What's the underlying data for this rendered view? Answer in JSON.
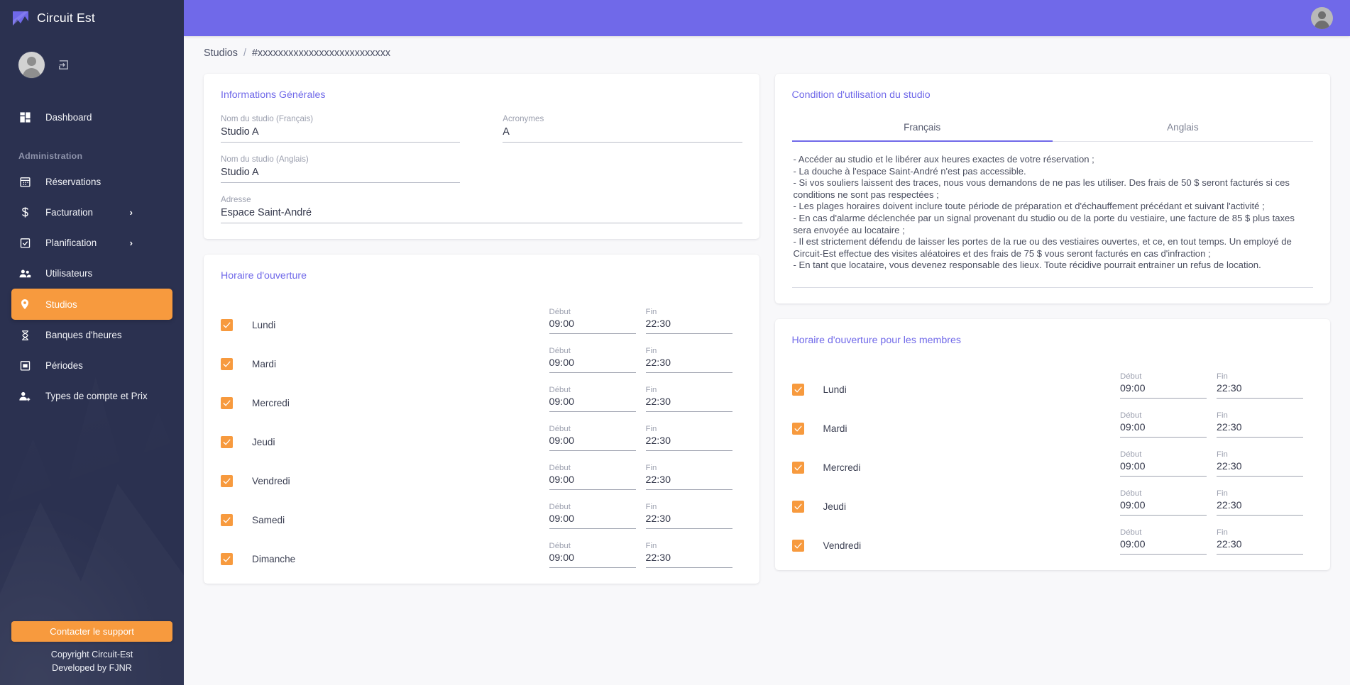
{
  "brand": {
    "name": "Circuit Est",
    "logo_icon": "mountain-logo-icon"
  },
  "sidebar": {
    "user": {
      "avatar_icon": "user-avatar-icon",
      "logout_icon": "logout-icon"
    },
    "dashboard": {
      "label": "Dashboard",
      "icon": "dashboard-grid-icon"
    },
    "section_label": "Administration",
    "items": [
      {
        "label": "Réservations",
        "icon": "calendar-grid-icon",
        "chevron": false
      },
      {
        "label": "Facturation",
        "icon": "dollar-icon",
        "chevron": true,
        "chevron_glyph": "›"
      },
      {
        "label": "Planification",
        "icon": "calendar-check-icon",
        "chevron": true,
        "chevron_glyph": "›"
      },
      {
        "label": "Utilisateurs",
        "icon": "people-icon",
        "chevron": false
      },
      {
        "label": "Studios",
        "icon": "map-pin-icon",
        "chevron": false,
        "active": true
      },
      {
        "label": "Banques d'heures",
        "icon": "hourglass-icon",
        "chevron": false
      },
      {
        "label": "Périodes",
        "icon": "calendar-block-icon",
        "chevron": false
      },
      {
        "label": "Types de compte et Prix",
        "icon": "person-gear-icon",
        "chevron": false
      }
    ],
    "support_button": "Contacter le support",
    "copyright_line1": "Copyright Circuit-Est",
    "copyright_line2": "Developed by FJNR"
  },
  "topbar": {
    "avatar_icon": "user-avatar-icon"
  },
  "breadcrumb": {
    "root": "Studios",
    "separator": "/",
    "current": "#xxxxxxxxxxxxxxxxxxxxxxxxxx"
  },
  "general_info": {
    "title": "Informations Générales",
    "fields": {
      "name_fr": {
        "label": "Nom du studio (Français)",
        "value": "Studio A",
        "placeholder": "Nom du studio (Français)"
      },
      "acronyms": {
        "label": "Acronymes",
        "value": "A",
        "placeholder": "Acronymes"
      },
      "name_en": {
        "label": "Nom du studio (Anglais)",
        "value": "Studio A",
        "placeholder": "Nom du studio (Anglais)"
      },
      "address": {
        "label": "Adresse",
        "value": "Espace Saint-André",
        "placeholder": "Adresse"
      }
    }
  },
  "conditions": {
    "title": "Condition d'utilisation du studio",
    "tabs": [
      {
        "label": "Français",
        "active": true
      },
      {
        "label": "Anglais",
        "active": false
      }
    ],
    "text": "- Accéder au studio et le libérer aux heures exactes de votre réservation ;\n- La douche à l'espace Saint-André n'est pas accessible.\n- Si vos souliers laissent des traces, nous vous demandons de ne pas les utiliser. Des frais de 50 $ seront facturés si ces conditions ne sont pas respectées ;\n- Les plages horaires doivent inclure toute période de préparation et d'échauffement précédant et suivant l'activité ;\n- En cas d'alarme déclenchée par un signal provenant du studio ou de la porte du vestiaire, une facture de 85 $ plus taxes sera envoyée au locataire ;\n- Il est strictement défendu de laisser les portes de la rue ou des vestiaires ouvertes, et ce, en tout temps. Un employé de Circuit-Est effectue des visites aléatoires et des frais de 75 $ vous seront facturés en cas d'infraction ;\n- En tant que locataire, vous devenez responsable des lieux. Toute récidive pourrait entrainer un refus de location."
  },
  "schedule_public": {
    "title": "Horaire d'ouverture",
    "col_start_label": "Début",
    "col_end_label": "Fin",
    "days": [
      {
        "day": "Lundi",
        "checked": true,
        "start": "09:00",
        "end": "22:30"
      },
      {
        "day": "Mardi",
        "checked": true,
        "start": "09:00",
        "end": "22:30"
      },
      {
        "day": "Mercredi",
        "checked": true,
        "start": "09:00",
        "end": "22:30"
      },
      {
        "day": "Jeudi",
        "checked": true,
        "start": "09:00",
        "end": "22:30"
      },
      {
        "day": "Vendredi",
        "checked": true,
        "start": "09:00",
        "end": "22:30"
      },
      {
        "day": "Samedi",
        "checked": true,
        "start": "09:00",
        "end": "22:30"
      },
      {
        "day": "Dimanche",
        "checked": true,
        "start": "09:00",
        "end": "22:30"
      }
    ]
  },
  "schedule_members": {
    "title": "Horaire d'ouverture pour les membres",
    "col_start_label": "Début",
    "col_end_label": "Fin",
    "days": [
      {
        "day": "Lundi",
        "checked": true,
        "start": "09:00",
        "end": "22:30"
      },
      {
        "day": "Mardi",
        "checked": true,
        "start": "09:00",
        "end": "22:30"
      },
      {
        "day": "Mercredi",
        "checked": true,
        "start": "09:00",
        "end": "22:30"
      },
      {
        "day": "Jeudi",
        "checked": true,
        "start": "09:00",
        "end": "22:30"
      },
      {
        "day": "Vendredi",
        "checked": true,
        "start": "09:00",
        "end": "22:30"
      }
    ]
  },
  "colors": {
    "accent_purple": "#7069e9",
    "accent_orange": "#f79a3e",
    "sidebar_bg": "#2b3150",
    "page_bg": "#f8f8fa",
    "text_dark": "#33374a",
    "label_grey": "#9b9fae"
  }
}
